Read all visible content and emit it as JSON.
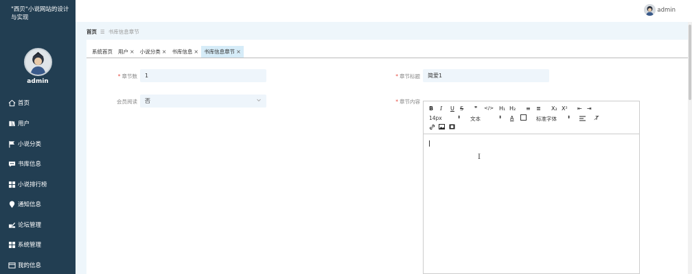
{
  "sidebar": {
    "brand": "\"西贝\"小说网站的设计与实现",
    "user": "admin",
    "items": [
      {
        "label": "首页",
        "icon": "home-icon"
      },
      {
        "label": "用户",
        "icon": "user-book-icon"
      },
      {
        "label": "小说分类",
        "icon": "flag-icon"
      },
      {
        "label": "书库信息",
        "icon": "chat-icon"
      },
      {
        "label": "小说排行榜",
        "icon": "grid-icon"
      },
      {
        "label": "通知信息",
        "icon": "pin-icon"
      },
      {
        "label": "论坛管理",
        "icon": "forum-icon"
      },
      {
        "label": "系统管理",
        "icon": "grid-icon"
      },
      {
        "label": "我的信息",
        "icon": "card-icon"
      }
    ]
  },
  "topbar": {
    "user": "admin"
  },
  "breadcrumb": {
    "home": "首页",
    "separator": "☰",
    "current": "书库信息章节"
  },
  "tabs": [
    {
      "label": "系统首页",
      "closable": false,
      "active": false
    },
    {
      "label": "用户",
      "closable": true,
      "active": false
    },
    {
      "label": "小说分类",
      "closable": true,
      "active": false
    },
    {
      "label": "书库信息",
      "closable": true,
      "active": false
    },
    {
      "label": "书库信息章节",
      "closable": true,
      "active": true
    }
  ],
  "form": {
    "chapter_no_label": "章节数",
    "chapter_no_value": "1",
    "chapter_title_label": "章节标题",
    "chapter_title_value": "简爱1",
    "member_read_label": "会员阅读",
    "member_read_value": "否",
    "chapter_content_label": "章节内容",
    "required_mark": "*"
  },
  "editor": {
    "row1": [
      "B",
      "I",
      "U",
      "S",
      "❞",
      "</>",
      "H₁",
      "H₂",
      "≡",
      "≣",
      "X₂",
      "X²",
      "⇤",
      "⇥"
    ],
    "font_size": "14px",
    "block_type": "文本",
    "font_family": "标准字体",
    "color_icon": "A",
    "clear_format": "T̸",
    "content": ""
  },
  "colors": {
    "sidebar_bg": "#223e52",
    "active_tab_bg": "#d6ecf8",
    "input_bg": "#eef5fb",
    "required": "#e54d42"
  }
}
